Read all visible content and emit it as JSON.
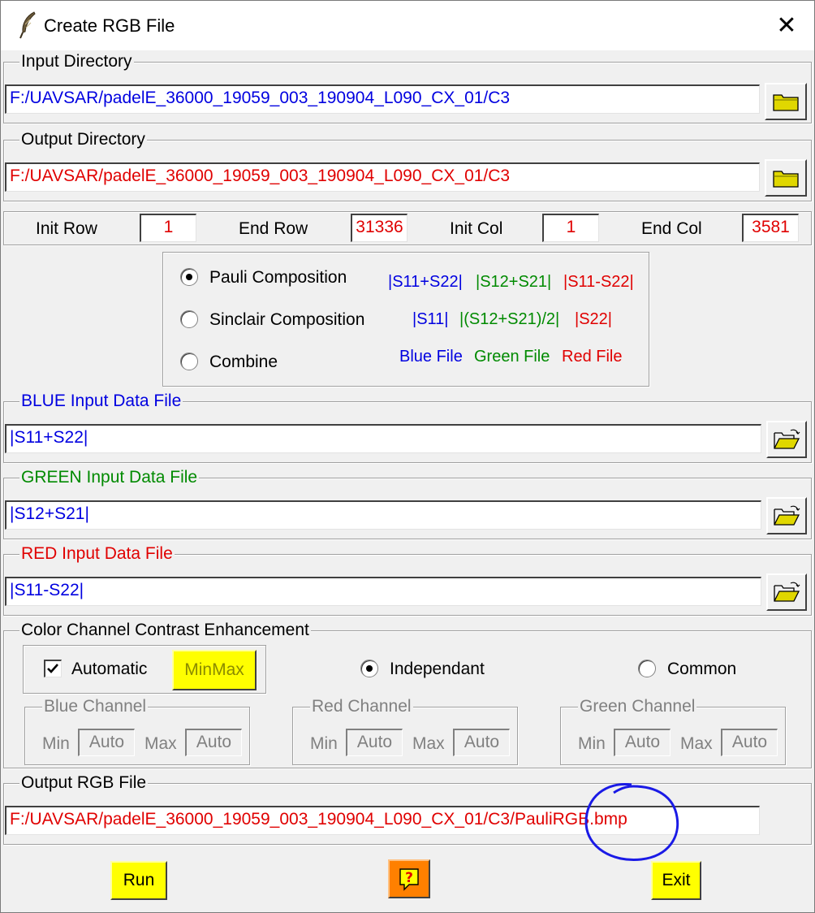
{
  "window": {
    "title": "Create RGB File",
    "close_glyph": "✕"
  },
  "input_dir": {
    "legend": "Input Directory",
    "value": "F:/UAVSAR/padelE_36000_19059_003_190904_L090_CX_01/C3"
  },
  "output_dir": {
    "legend": "Output Directory",
    "value": "F:/UAVSAR/padelE_36000_19059_003_190904_L090_CX_01/C3"
  },
  "rowcol": {
    "init_row_label": "Init Row",
    "init_row": "1",
    "end_row_label": "End Row",
    "end_row": "31336",
    "init_col_label": "Init Col",
    "init_col": "1",
    "end_col_label": "End Col",
    "end_col": "3581"
  },
  "composition": {
    "pauli_label": "Pauli Composition",
    "pauli_blue": "|S11+S22|",
    "pauli_green": "|S12+S21|",
    "pauli_red": "|S11-S22|",
    "sinclair_label": "Sinclair Composition",
    "sinclair_blue": "|S11|",
    "sinclair_green": "|(S12+S21)/2|",
    "sinclair_red": "|S22|",
    "combine_label": "Combine",
    "combine_blue": "Blue File",
    "combine_green": "Green File",
    "combine_red": "Red File",
    "selected": "pauli"
  },
  "blue_file": {
    "legend": "BLUE Input Data File",
    "value": "|S11+S22|"
  },
  "green_file": {
    "legend": "GREEN Input Data File",
    "value": "|S12+S21|"
  },
  "red_file": {
    "legend": "RED Input Data File",
    "value": "|S11-S22|"
  },
  "contrast": {
    "legend": "Color Channel Contrast Enhancement",
    "automatic_label": "Automatic",
    "automatic_checked": true,
    "minmax_label": "MinMax",
    "independant_label": "Independant",
    "common_label": "Common",
    "min_label": "Min",
    "max_label": "Max",
    "auto_value": "Auto",
    "blue_channel": "Blue Channel",
    "red_channel": "Red Channel",
    "green_channel": "Green Channel"
  },
  "output_rgb": {
    "legend": "Output RGB File",
    "value": "F:/UAVSAR/padelE_36000_19059_003_190904_L090_CX_01/C3/PauliRGB.bmp"
  },
  "buttons": {
    "run": "Run",
    "help": "?",
    "exit": "Exit"
  },
  "colors": {
    "accent_yellow": "#ffff00",
    "help_orange": "#ff8000",
    "annotation_blue": "#1a1ae6"
  },
  "icons": {
    "folder": "folder-icon",
    "folder_open": "folder-open-icon",
    "feather": "feather-icon"
  }
}
